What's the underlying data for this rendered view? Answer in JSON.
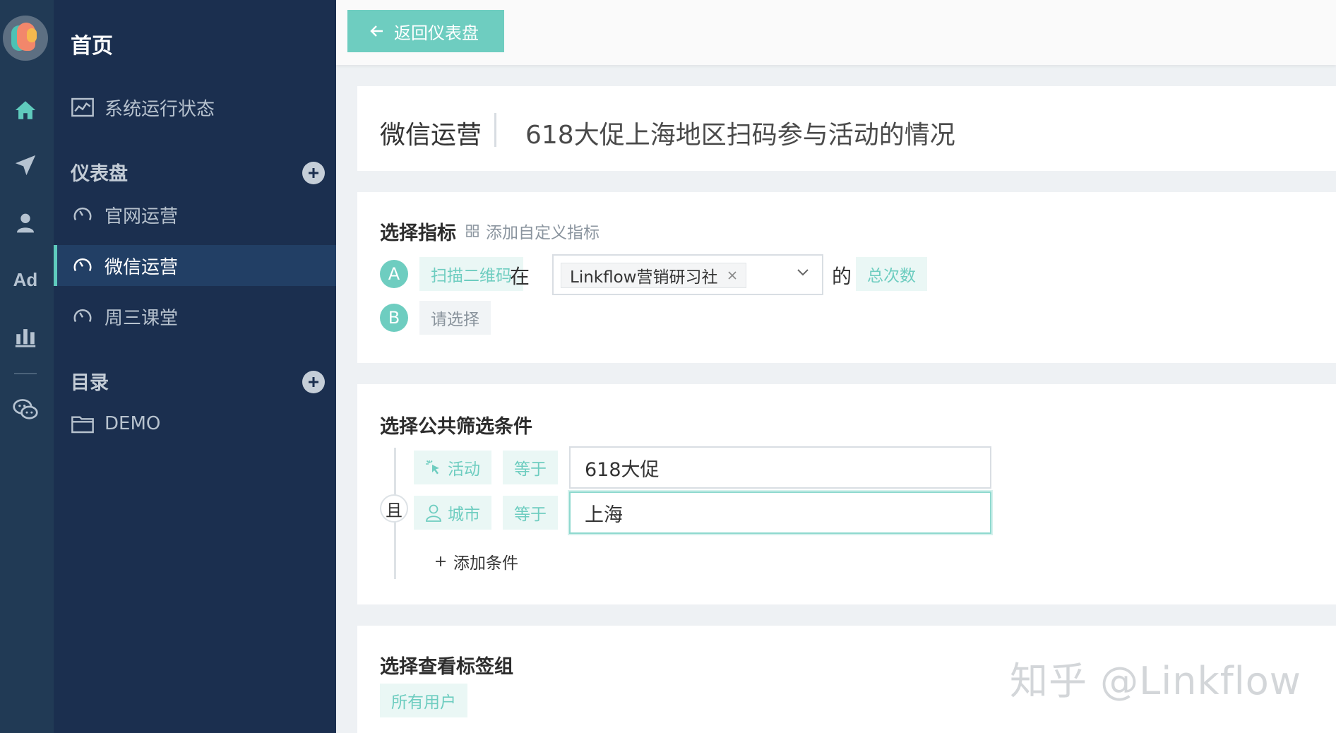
{
  "rail": {
    "ad_label": "Ad"
  },
  "nav": {
    "home": "首页",
    "system_status": "系统运行状态",
    "dashboard_section": "仪表盘",
    "dashboards": [
      "官网运营",
      "微信运营",
      "周三课堂"
    ],
    "catalog_section": "目录",
    "catalog_items": [
      "DEMO"
    ]
  },
  "topbar": {
    "back_label": "返回仪表盘"
  },
  "title": {
    "dashboard": "微信运营",
    "report": "618大促上海地区扫码参与活动的情况"
  },
  "metrics": {
    "title": "选择指标",
    "add_custom": "添加自定义指标",
    "rows": [
      {
        "letter": "A",
        "event": "扫描二维码",
        "in_word": "在",
        "account_tag": "Linkflow营销研习社",
        "of_word": "的",
        "measure": "总次数"
      },
      {
        "letter": "B",
        "placeholder": "请选择"
      }
    ]
  },
  "filters": {
    "title": "选择公共筛选条件",
    "and_label": "且",
    "conditions": [
      {
        "field": "活动",
        "operator": "等于",
        "value": "618大促"
      },
      {
        "field": "城市",
        "operator": "等于",
        "value": "上海"
      }
    ],
    "add_condition": "添加条件"
  },
  "tag_group": {
    "title": "选择查看标签组",
    "value": "所有用户"
  },
  "watermark": "知乎 @Linkflow",
  "colors": {
    "accent": "#6ecdc0",
    "rail_bg": "#213a55",
    "nav_bg": "#1b2f4f",
    "nav_active": "#223f65"
  }
}
